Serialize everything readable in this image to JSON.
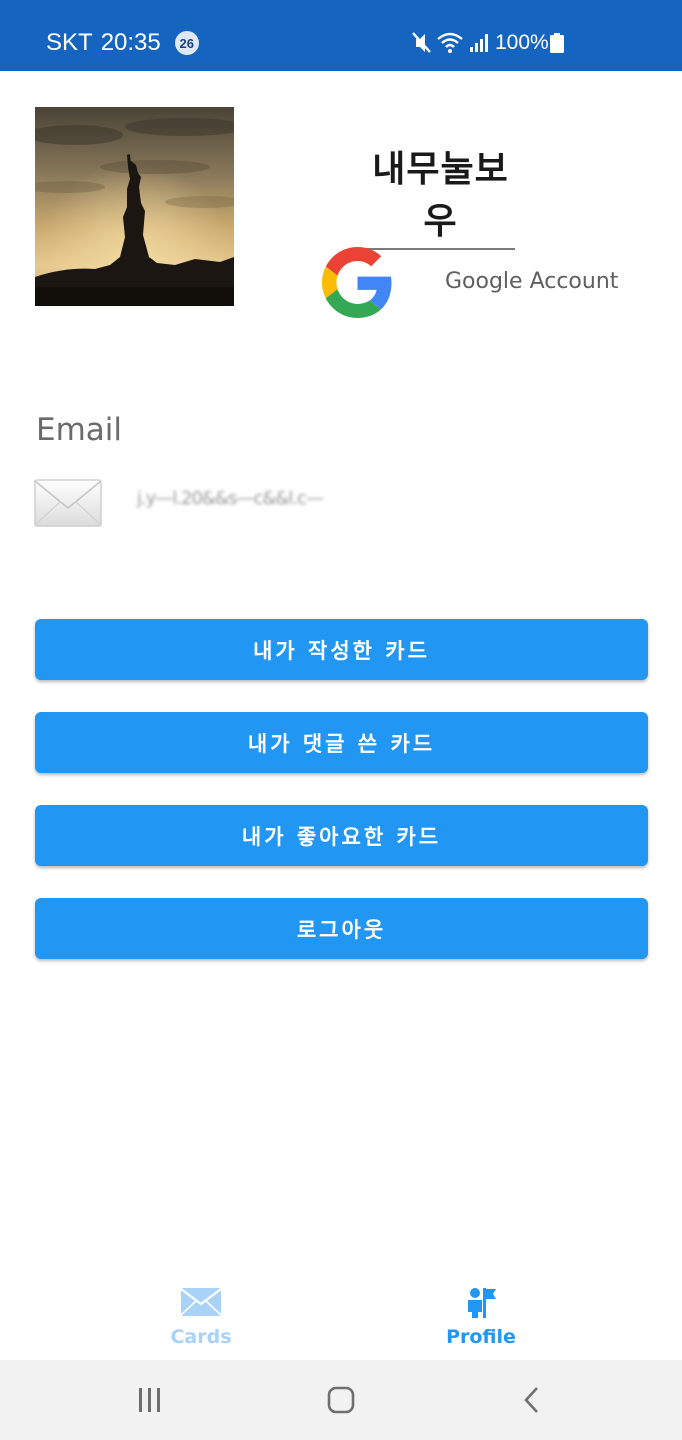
{
  "status_bar": {
    "carrier": "SKT",
    "time": "20:35",
    "notification_count": "26",
    "battery": "100%",
    "icons": [
      "mute-icon",
      "wifi-icon",
      "signal-icon",
      "battery-icon"
    ],
    "background_color": "#1565c0"
  },
  "profile": {
    "name": "내무눌보우",
    "account_label": "Google Account",
    "avatar_icon": "statue-of-liberty-photo"
  },
  "email": {
    "heading": "Email",
    "value": "j.y—l.20&&s—c&&l.c—",
    "icon": "envelope-icon"
  },
  "buttons": {
    "my_cards": "내가 작성한 카드",
    "commented_cards": "내가 댓글 쓴 카드",
    "liked_cards": "내가 좋아요한 카드",
    "logout": "로그아웃",
    "color": "#2196f3"
  },
  "bottom_nav": {
    "cards_label": "Cards",
    "profile_label": "Profile",
    "active_tab": "Profile",
    "active_color": "#2196f3",
    "inactive_color": "#a8d2f7"
  },
  "system_nav": {
    "icons": [
      "recents-icon",
      "home-icon",
      "back-icon"
    ]
  }
}
